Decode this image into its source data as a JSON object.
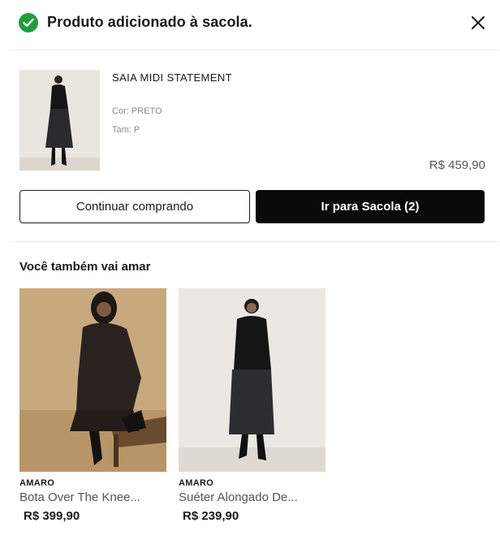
{
  "header": {
    "title": "Produto adicionado à sacola.",
    "icons": {
      "status": "check-circle-icon",
      "close": "close-icon"
    }
  },
  "cart_item": {
    "name": "SAIA MIDI STATEMENT",
    "color": "Cor: PRETO",
    "size": "Tam: P",
    "price": "R$ 459,90"
  },
  "actions": {
    "continue_label": "Continuar comprando",
    "go_to_bag_label": "Ir para Sacola (2)"
  },
  "recommendations": {
    "title": "Você também vai amar",
    "items": [
      {
        "brand": "AMARO",
        "name": "Bota Over The Knee...",
        "price": "R$ 399,90"
      },
      {
        "brand": "AMARO",
        "name": "Suéter Alongado De...",
        "price": "R$ 239,90"
      }
    ]
  },
  "colors": {
    "success": "#1e9e3a",
    "primary_button": "#0a0a0a",
    "muted_text": "#8a8a8a"
  }
}
